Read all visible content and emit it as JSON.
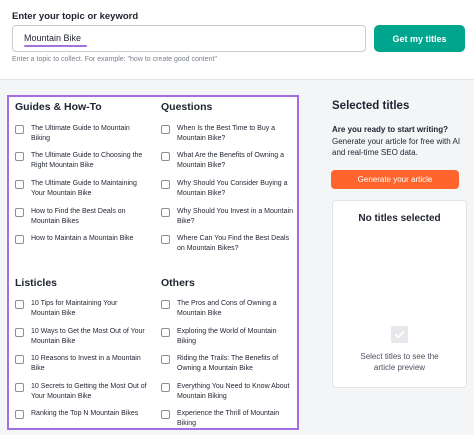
{
  "topic": {
    "label": "Enter your topic or keyword",
    "value": "Mountain Bike",
    "hint": "Enter a topic to collect. For example: \"how to create good content\"",
    "submit_label": "Get my titles"
  },
  "sections": [
    {
      "title": "Guides & How-To",
      "items": [
        "The Ultimate Guide to Mountain Biking",
        "The Ultimate Guide to Choosing the Right Mountain Bike",
        "The Ultimate Guide to Maintaining Your Mountain Bike",
        "How to Find the Best Deals on Mountain Bikes",
        "How to Maintain a Mountain Bike"
      ]
    },
    {
      "title": "Questions",
      "items": [
        "When Is the Best Time to Buy a Mountain Bike?",
        "What Are the Benefits of Owning a Mountain Bike?",
        "Why Should You Consider Buying a Mountain Bike?",
        "Why Should You Invest in a Mountain Bike?",
        "Where Can You Find the Best Deals on Mountain Bikes?"
      ]
    },
    {
      "title": "Listicles",
      "items": [
        "10 Tips for Maintaining Your Mountain Bike",
        "10 Ways to Get the Most Out of Your Mountain Bike",
        "10 Reasons to Invest in a Mountain Bike",
        "10 Secrets to Getting the Most Out of Your Mountain Bike",
        "Ranking the Top N Mountain Bikes"
      ]
    },
    {
      "title": "Others",
      "items": [
        "The Pros and Cons of Owning a Mountain Bike",
        "Exploring the World of Mountain Biking",
        "Riding the Trails: The Benefits of Owning a Mountain Bike",
        "Everything You Need to Know About Mountain Biking",
        "Experience the Thrill of Mountain Biking"
      ]
    }
  ],
  "selected": {
    "title": "Selected titles",
    "ready": "Are you ready to start writing?",
    "description": "Generate your article for free with AI and real-time SEO data.",
    "generate_label": "Generate your article",
    "empty_title": "No titles selected",
    "empty_description": "Select titles to see the article preview"
  },
  "colors": {
    "primary_green": "#00a58e",
    "accent_orange": "#ff642d",
    "highlight_purple": "#a46ee3"
  }
}
